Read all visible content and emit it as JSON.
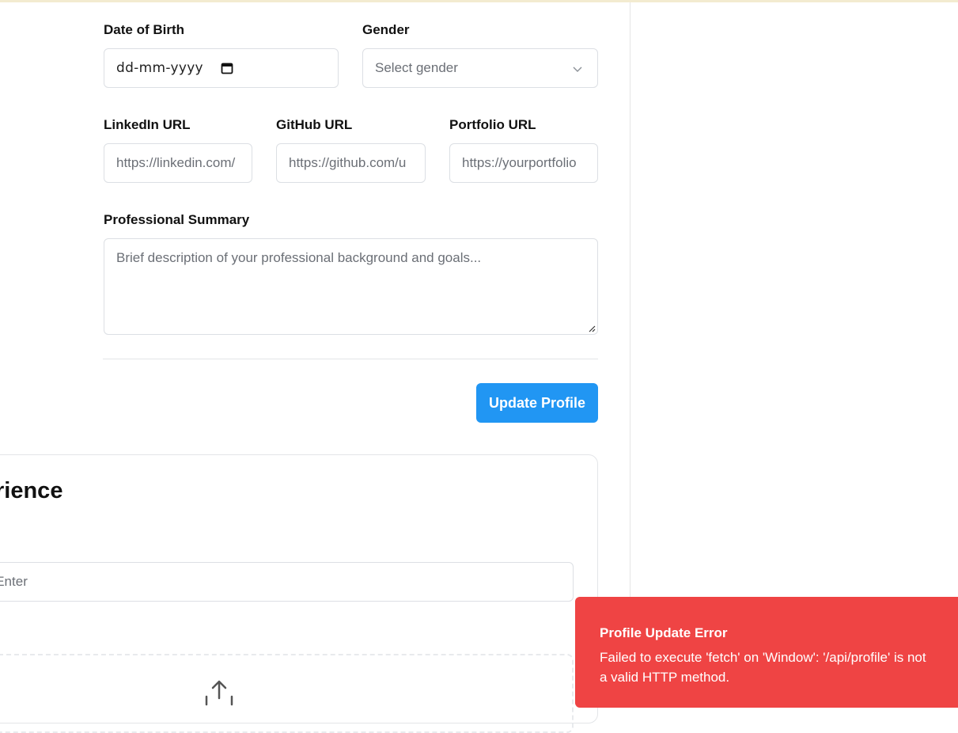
{
  "form": {
    "dob": {
      "label": "Date of Birth",
      "value": "dd-mm-yyyy"
    },
    "gender": {
      "label": "Gender",
      "placeholder": "Select gender"
    },
    "linkedin": {
      "label": "LinkedIn URL",
      "placeholder": "https://linkedin.com/"
    },
    "github": {
      "label": "GitHub URL",
      "placeholder": "https://github.com/u"
    },
    "portfolio": {
      "label": "Portfolio URL",
      "placeholder": "https://yourportfolio"
    },
    "summary": {
      "label": "Professional Summary",
      "placeholder": "Brief description of your professional background and goals..."
    },
    "submit_label": "Update Profile"
  },
  "experience_card": {
    "title": "rience",
    "skill_input_placeholder": "s Enter"
  },
  "toast": {
    "title": "Profile Update Error",
    "message": "Failed to execute 'fetch' on 'Window': '/api/profile' is not a valid HTTP method.",
    "color": "#ef4444"
  },
  "icons": {
    "date": "calendar-icon",
    "gender": "chevron-down-icon",
    "upload": "upload-icon"
  }
}
